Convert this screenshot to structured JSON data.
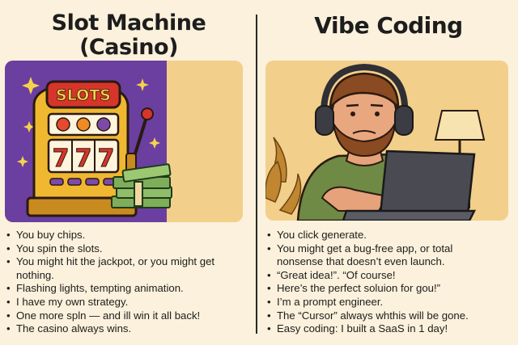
{
  "left": {
    "title_line1": "Slot Machine",
    "title_line2": "(Casino)",
    "sign_text": "SLOTS",
    "reel_digits": [
      "7",
      "7",
      "7"
    ],
    "bullets": [
      "You buy chips.",
      "You spin the slots.",
      "You might hit the jackpot, or you might get",
      "nothing.",
      "Flashing lights, tempting animation.",
      "I have my own strategy.",
      "One more spln — and ill win it all back!",
      "The casino always wins."
    ]
  },
  "right": {
    "title": "Vibe Coding",
    "bullets": [
      "You click generate.",
      "You might get a  bug-free app, or total",
      "nonsense that doesn’t even launch.",
      "“Great idea!”. “Of course!",
      "Here’s the perfect soluion for gou!”",
      "I’m a prompt engineer.",
      "The “Cursor” always whthis will be gone.",
      "Easy coding: I built a SaaS in 1 day!"
    ]
  },
  "colors": {
    "background": "#fbf1dc",
    "panel": "#f2cf8a",
    "casino_purple": "#6a3fa0",
    "machine_gold": "#f0b731",
    "sign_red": "#d8352a",
    "shirt_green": "#6e8a45",
    "laptop": "#4a4a52"
  }
}
